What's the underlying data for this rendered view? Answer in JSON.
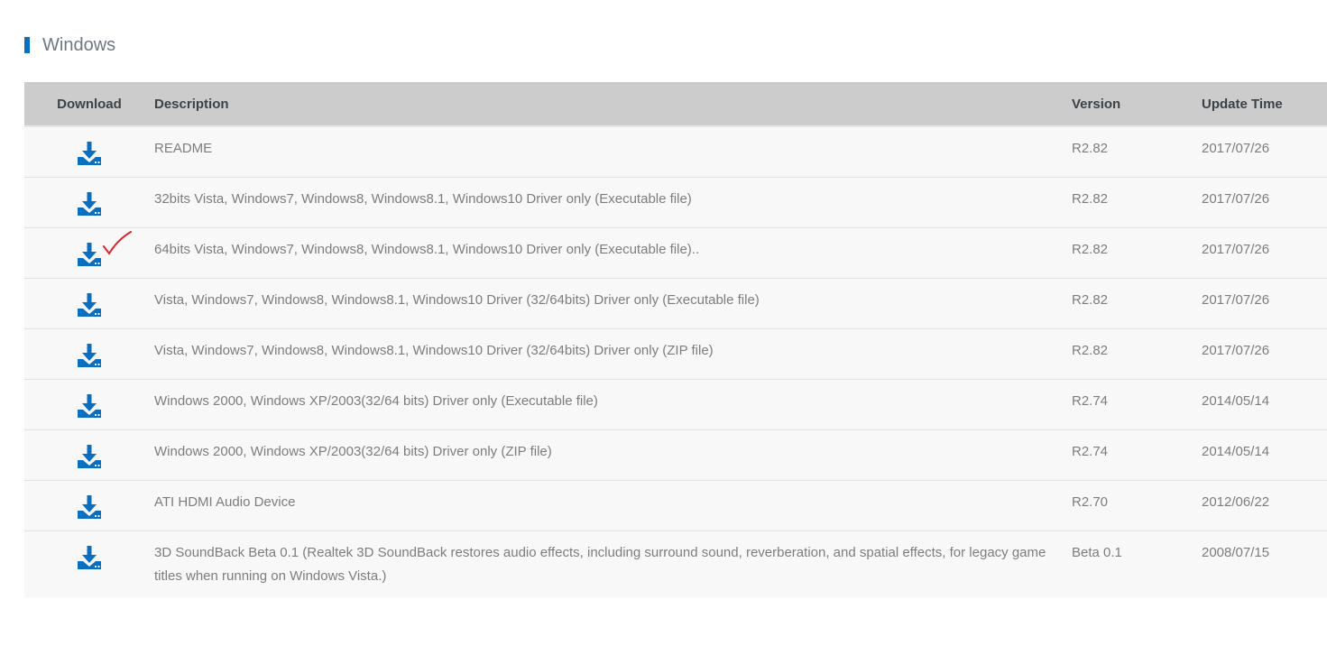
{
  "section": {
    "title": "Windows"
  },
  "colors": {
    "accent": "#0a6fbf",
    "header_bg": "#cccccc",
    "row_bg": "#f8f8f8",
    "mark": "#d9262e"
  },
  "table": {
    "headers": {
      "download": "Download",
      "description": "Description",
      "version": "Version",
      "update_time": "Update Time"
    },
    "rows": [
      {
        "icon": "download-icon",
        "description": "README",
        "version": "R2.82",
        "date": "2017/07/26"
      },
      {
        "icon": "download-icon",
        "description": "32bits Vista, Windows7, Windows8, Windows8.1, Windows10 Driver only (Executable file)",
        "version": "R2.82",
        "date": "2017/07/26"
      },
      {
        "icon": "download-icon",
        "description": "64bits Vista, Windows7, Windows8, Windows8.1, Windows10 Driver only (Executable file)..",
        "version": "R2.82",
        "date": "2017/07/26",
        "marked": true
      },
      {
        "icon": "download-icon",
        "description": "Vista, Windows7, Windows8, Windows8.1, Windows10 Driver (32/64bits) Driver only (Executable file)",
        "version": "R2.82",
        "date": "2017/07/26"
      },
      {
        "icon": "download-icon",
        "description": "Vista, Windows7, Windows8, Windows8.1, Windows10 Driver (32/64bits) Driver only (ZIP file)",
        "version": "R2.82",
        "date": "2017/07/26"
      },
      {
        "icon": "download-icon",
        "description": "Windows 2000, Windows XP/2003(32/64 bits) Driver only (Executable file)",
        "version": "R2.74",
        "date": "2014/05/14"
      },
      {
        "icon": "download-icon",
        "description": "Windows 2000, Windows XP/2003(32/64 bits) Driver only (ZIP file)",
        "version": "R2.74",
        "date": "2014/05/14"
      },
      {
        "icon": "download-icon",
        "description": "ATI HDMI Audio Device",
        "version": "R2.70",
        "date": "2012/06/22"
      },
      {
        "icon": "download-icon",
        "description": "3D SoundBack Beta 0.1 (Realtek 3D SoundBack restores audio effects, including surround sound, reverberation, and spatial effects, for legacy game titles when running on Windows Vista.)",
        "version": "Beta 0.1",
        "date": "2008/07/15"
      }
    ]
  }
}
